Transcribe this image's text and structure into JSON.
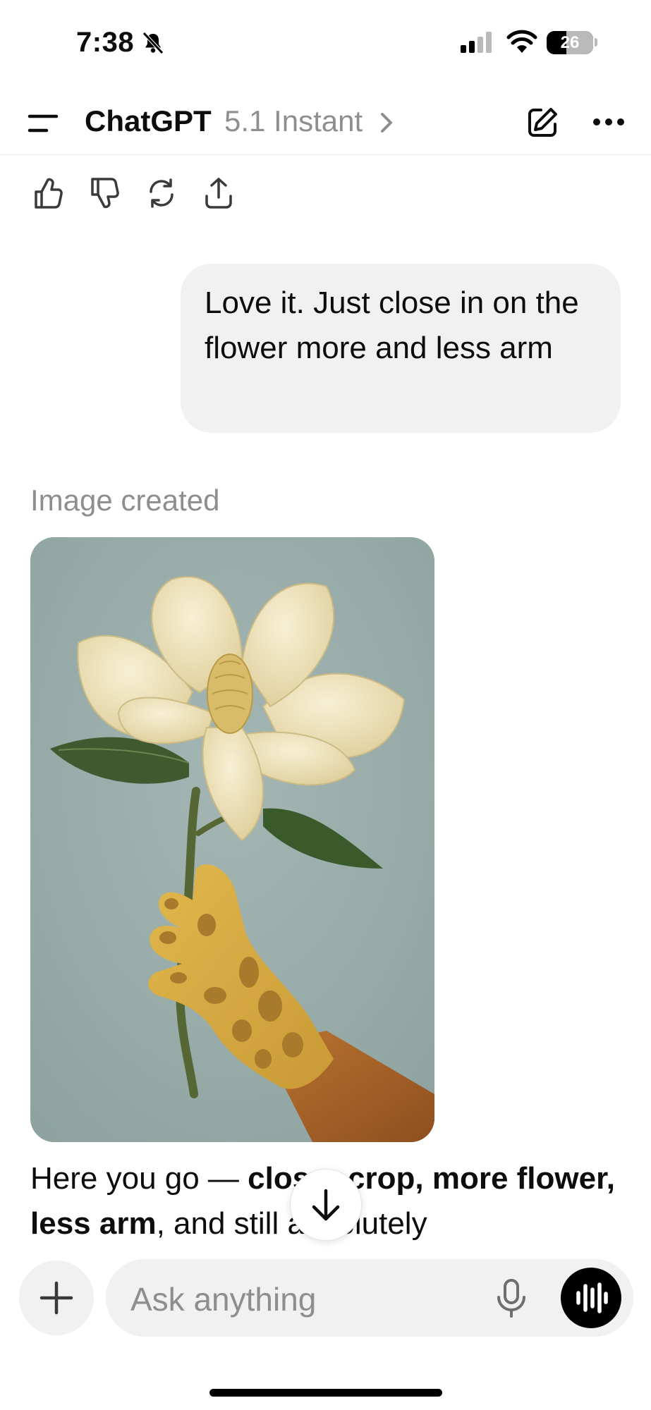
{
  "status_bar": {
    "time": "7:38",
    "battery": "26"
  },
  "header": {
    "title": "ChatGPT",
    "model": "5.1 Instant"
  },
  "conversation": {
    "user_message": "Love it.  Just close in on the flower more and less arm",
    "image_status": "Image created",
    "reply": {
      "part1": "Here you go — ",
      "bold1": "closer crop, more flower, less arm",
      "part2": ", and still absolutely"
    }
  },
  "composer": {
    "placeholder": "Ask anything"
  },
  "icons": [
    "menu-icon",
    "chevron-right-icon",
    "edit-icon",
    "more-icon",
    "thumbs-up-icon",
    "thumbs-down-icon",
    "regenerate-icon",
    "share-icon",
    "arrow-down-icon",
    "plus-icon",
    "mic-icon",
    "voice-waveform-icon"
  ],
  "colors": {
    "bubble": "#f1f1f1",
    "muted_text": "#8e8e8e",
    "image_background": "#95a9a7"
  }
}
